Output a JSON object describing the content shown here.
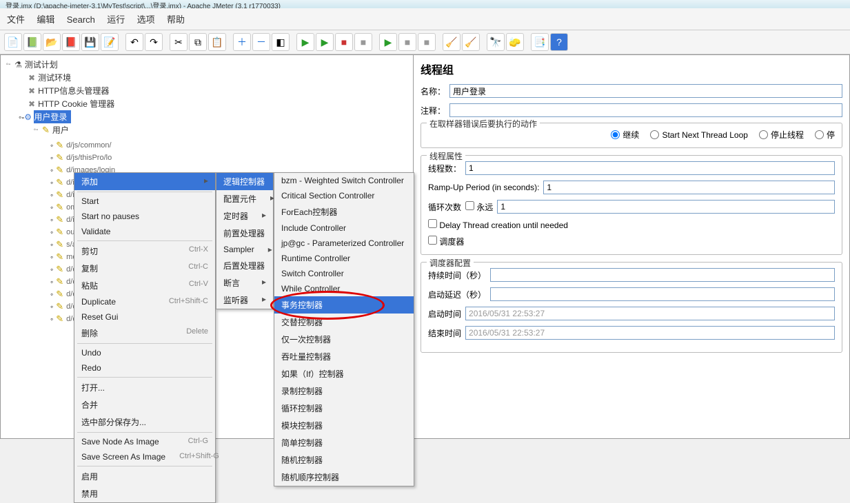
{
  "title": "登录.jmx (D:\\apache-jmeter-3.1\\MyTest\\script\\...\\登录.jmx) - Apache JMeter (3.1 r1770033)",
  "menus": {
    "file": "文件",
    "edit": "编辑",
    "search": "Search",
    "run": "运行",
    "options": "选项",
    "help": "帮助"
  },
  "tree": {
    "root": "测试计划",
    "env": "测试环境",
    "hm": "HTTP信息头管理器",
    "cookie": "HTTP Cookie 管理器",
    "login": "用户登录",
    "child": "用户"
  },
  "tree_rows": [
    "d/js/common/",
    "d/js/thisPro/lo",
    "d/images/login",
    "d/images/user",
    "d/images/pwdB",
    "ommon/getCo",
    "d/images/loadi",
    "ouKongUserI",
    "s/admin/index",
    "mon/common.",
    "d/css/bootstra",
    "d/css/ace.css",
    "d/css/ace-rtl.",
    "d/css/ace-skins",
    "d/css/themes/metro/easyui.css"
  ],
  "context1": {
    "add": "添加",
    "start": "Start",
    "start_np": "Start no pauses",
    "validate": "Validate",
    "cut": "剪切",
    "cut_sc": "Ctrl-X",
    "copy": "复制",
    "copy_sc": "Ctrl-C",
    "paste": "粘贴",
    "paste_sc": "Ctrl-V",
    "dup": "Duplicate",
    "dup_sc": "Ctrl+Shift-C",
    "reset": "Reset Gui",
    "delete": "删除",
    "delete_sc": "Delete",
    "undo": "Undo",
    "redo": "Redo",
    "open": "打开...",
    "merge": "合并",
    "save_sel": "选中部分保存为...",
    "save_node": "Save Node As Image",
    "save_node_sc": "Ctrl-G",
    "save_screen": "Save Screen As Image",
    "save_screen_sc": "Ctrl+Shift-G",
    "enable": "启用",
    "disable": "禁用"
  },
  "context2": {
    "logic": "逻辑控制器",
    "config": "配置元件",
    "timer": "定时器",
    "pre": "前置处理器",
    "sampler": "Sampler",
    "post": "后置处理器",
    "assert": "断言",
    "listener": "监听器"
  },
  "context3": {
    "items": [
      "bzm - Weighted Switch Controller",
      "Critical Section Controller",
      "ForEach控制器",
      "Include Controller",
      "jp@gc - Parameterized Controller",
      "Runtime Controller",
      "Switch Controller",
      "While Controller",
      "事务控制器",
      "交替控制器",
      "仅一次控制器",
      "吞吐量控制器",
      "如果（If）控制器",
      "录制控制器",
      "循环控制器",
      "模块控制器",
      "简单控制器",
      "随机控制器",
      "随机顺序控制器"
    ],
    "highlight_index": 8
  },
  "panel": {
    "header": "线程组",
    "name_lbl": "名称：",
    "name_val": "用户登录",
    "notes_lbl": "注释：",
    "err_legend": "在取样器错误后要执行的动作",
    "r_continue": "继续",
    "r_next": "Start Next Thread Loop",
    "r_stop_thread": "停止线程",
    "r_stop": "停",
    "props_legend": "线程属性",
    "threads_lbl": "线程数：",
    "threads_val": "1",
    "ramp_lbl": "Ramp-Up Period (in seconds):",
    "ramp_val": "1",
    "loop_lbl": "循环次数",
    "forever_lbl": "永远",
    "loop_val": "1",
    "delay_lbl": "Delay Thread creation until needed",
    "sched_lbl": "调度器",
    "sched_legend": "调度器配置",
    "dur_lbl": "持续时间（秒）",
    "delay2_lbl": "启动延迟（秒）",
    "start_lbl": "启动时间",
    "start_val": "2016/05/31 22:53:27",
    "end_lbl": "结束时间",
    "end_val": "2016/05/31 22:53:27"
  }
}
